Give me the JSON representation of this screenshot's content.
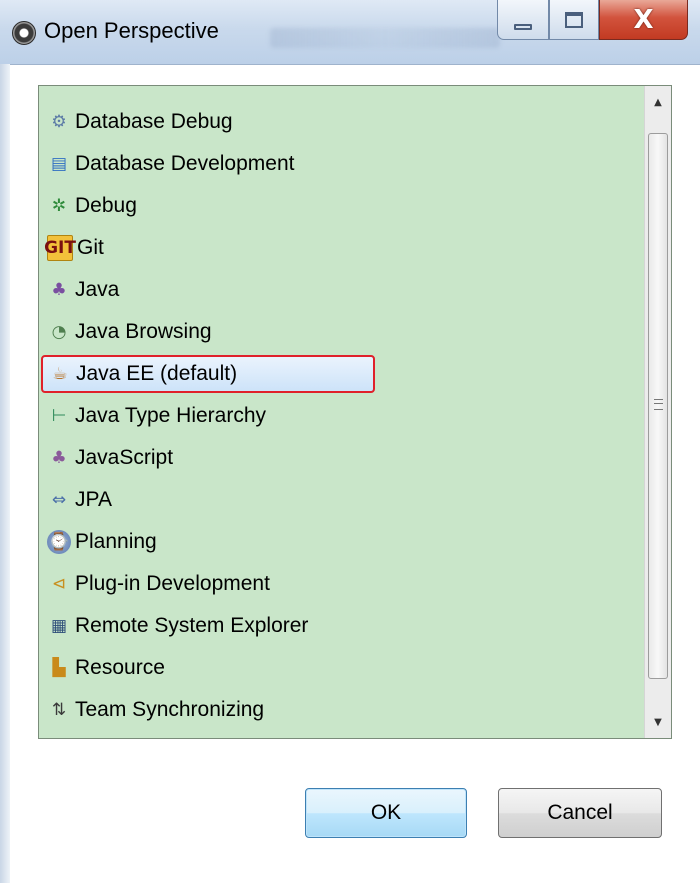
{
  "window": {
    "title": "Open Perspective",
    "controls": {
      "minimize": "minimize-icon",
      "maximize": "maximize-icon",
      "close_glyph": "X"
    }
  },
  "perspectives": {
    "selected_index": 6,
    "items": [
      {
        "label": "Database Debug",
        "icon": "database-debug-icon",
        "glyph": "⚙"
      },
      {
        "label": "Database Development",
        "icon": "database-development-icon",
        "glyph": "▤"
      },
      {
        "label": "Debug",
        "icon": "debug-bug-icon",
        "glyph": "✲"
      },
      {
        "label": "Git",
        "icon": "git-icon",
        "glyph": "GIT"
      },
      {
        "label": "Java",
        "icon": "java-icon",
        "glyph": "♣"
      },
      {
        "label": "Java Browsing",
        "icon": "java-browsing-icon",
        "glyph": "◔"
      },
      {
        "label": "Java EE (default)",
        "icon": "java-ee-icon",
        "glyph": "☕"
      },
      {
        "label": "Java Type Hierarchy",
        "icon": "java-type-hierarchy-icon",
        "glyph": "⊢"
      },
      {
        "label": "JavaScript",
        "icon": "javascript-icon",
        "glyph": "♣"
      },
      {
        "label": "JPA",
        "icon": "jpa-icon",
        "glyph": "⇔"
      },
      {
        "label": "Planning",
        "icon": "planning-icon",
        "glyph": "⌚"
      },
      {
        "label": "Plug-in Development",
        "icon": "plugin-development-icon",
        "glyph": "⊲"
      },
      {
        "label": "Remote System Explorer",
        "icon": "remote-system-explorer-icon",
        "glyph": "▦"
      },
      {
        "label": "Resource",
        "icon": "resource-folder-icon",
        "glyph": "▙"
      },
      {
        "label": "Team Synchronizing",
        "icon": "team-synchronizing-icon",
        "glyph": "⇅"
      }
    ]
  },
  "buttons": {
    "ok": "OK",
    "cancel": "Cancel"
  },
  "colors": {
    "list_background": "#c9e6c9",
    "selection_outline": "#e0202a",
    "close_button": "#c23a22"
  }
}
